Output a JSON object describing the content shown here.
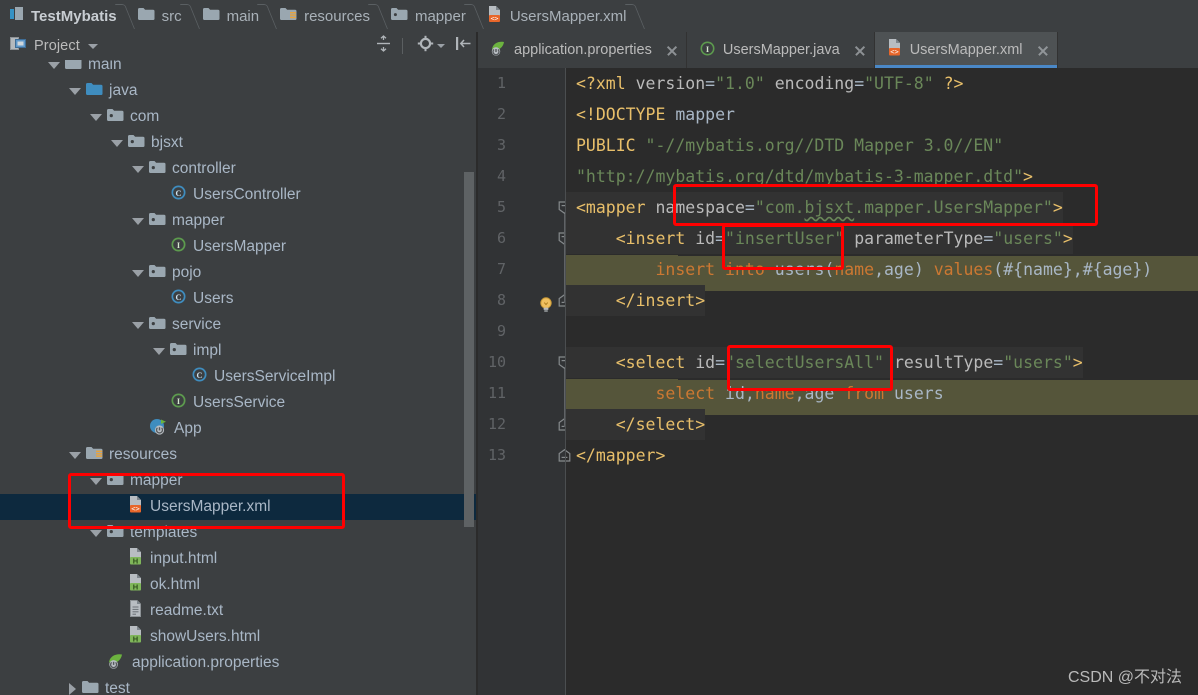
{
  "breadcrumb": {
    "items": [
      {
        "label": "TestMybatis",
        "icon": "module-icon"
      },
      {
        "label": "src",
        "icon": "folder-icon"
      },
      {
        "label": "main",
        "icon": "folder-icon"
      },
      {
        "label": "resources",
        "icon": "resources-folder-icon"
      },
      {
        "label": "mapper",
        "icon": "package-folder-icon"
      },
      {
        "label": "UsersMapper.xml",
        "icon": "xml-file-icon"
      }
    ]
  },
  "project_panel": {
    "title": "Project",
    "toolbar": [
      {
        "name": "expand-collapse-icon"
      },
      {
        "name": "gear-icon"
      },
      {
        "name": "hide-panel-icon"
      }
    ],
    "tree": [
      {
        "label": "main",
        "icon": "folder-icon",
        "indent": 2,
        "state": "expanded",
        "cut": true
      },
      {
        "label": "java",
        "icon": "source-folder-icon",
        "indent": 3,
        "state": "expanded"
      },
      {
        "label": "com",
        "icon": "package-folder-icon",
        "indent": 4,
        "state": "expanded"
      },
      {
        "label": "bjsxt",
        "icon": "package-folder-icon",
        "indent": 5,
        "state": "expanded"
      },
      {
        "label": "controller",
        "icon": "package-folder-icon",
        "indent": 6,
        "state": "expanded"
      },
      {
        "label": "UsersController",
        "icon": "class-icon",
        "indent": 7,
        "state": "leaf"
      },
      {
        "label": "mapper",
        "icon": "package-folder-icon",
        "indent": 6,
        "state": "expanded"
      },
      {
        "label": "UsersMapper",
        "icon": "interface-icon",
        "indent": 7,
        "state": "leaf"
      },
      {
        "label": "pojo",
        "icon": "package-folder-icon",
        "indent": 6,
        "state": "expanded"
      },
      {
        "label": "Users",
        "icon": "class-icon",
        "indent": 7,
        "state": "leaf"
      },
      {
        "label": "service",
        "icon": "package-folder-icon",
        "indent": 6,
        "state": "expanded"
      },
      {
        "label": "impl",
        "icon": "package-folder-icon",
        "indent": 7,
        "state": "expanded"
      },
      {
        "label": "UsersServiceImpl",
        "icon": "class-icon",
        "indent": 8,
        "state": "leaf"
      },
      {
        "label": "UsersService",
        "icon": "interface-icon",
        "indent": 7,
        "state": "leaf"
      },
      {
        "label": "App",
        "icon": "spring-boot-run-icon",
        "indent": 6,
        "state": "leaf"
      },
      {
        "label": "resources",
        "icon": "resources-folder-icon",
        "indent": 3,
        "state": "expanded"
      },
      {
        "label": "mapper",
        "icon": "package-folder-icon",
        "indent": 4,
        "state": "expanded"
      },
      {
        "label": "UsersMapper.xml",
        "icon": "xml-file-icon",
        "indent": 5,
        "state": "leaf",
        "selected": true
      },
      {
        "label": "templates",
        "icon": "package-folder-icon",
        "indent": 4,
        "state": "expanded"
      },
      {
        "label": "input.html",
        "icon": "html-file-icon",
        "indent": 5,
        "state": "leaf"
      },
      {
        "label": "ok.html",
        "icon": "html-file-icon",
        "indent": 5,
        "state": "leaf"
      },
      {
        "label": "readme.txt",
        "icon": "text-file-icon",
        "indent": 5,
        "state": "leaf"
      },
      {
        "label": "showUsers.html",
        "icon": "html-file-icon",
        "indent": 5,
        "state": "leaf"
      },
      {
        "label": "application.properties",
        "icon": "spring-properties-icon",
        "indent": 4,
        "state": "leaf"
      },
      {
        "label": "test",
        "icon": "folder-icon",
        "indent": 3,
        "state": "collapsed",
        "cut": true
      }
    ]
  },
  "editor_tabs": [
    {
      "label": "application.properties",
      "icon": "spring-properties-icon",
      "active": false,
      "closable": true
    },
    {
      "label": "UsersMapper.java",
      "icon": "interface-icon",
      "active": false,
      "closable": true
    },
    {
      "label": "UsersMapper.xml",
      "icon": "xml-file-icon",
      "active": true,
      "closable": true
    }
  ],
  "editor": {
    "filename": "UsersMapper.xml",
    "line_numbers": [
      "1",
      "2",
      "3",
      "4",
      "5",
      "6",
      "7",
      "8",
      "9",
      "10",
      "11",
      "12",
      "13"
    ],
    "lines": [
      {
        "n": 1,
        "text": "<?xml version=\"1.0\" encoding=\"UTF-8\" ?>"
      },
      {
        "n": 2,
        "text": "<!DOCTYPE mapper"
      },
      {
        "n": 3,
        "text": "PUBLIC \"-//mybatis.org//DTD Mapper 3.0//EN\""
      },
      {
        "n": 4,
        "text": "\"http://mybatis.org/dtd/mybatis-3-mapper.dtd\">"
      },
      {
        "n": 5,
        "text": "<mapper namespace=\"com.bjsxt.mapper.UsersMapper\">"
      },
      {
        "n": 6,
        "text": "    <insert id=\"insertUser\" parameterType=\"users\">"
      },
      {
        "n": 7,
        "text": "        insert into users(name,age) values(#{name},#{age})"
      },
      {
        "n": 8,
        "text": "    </insert>"
      },
      {
        "n": 9,
        "text": ""
      },
      {
        "n": 10,
        "text": "    <select id=\"selectUsersAll\" resultType=\"users\">"
      },
      {
        "n": 11,
        "text": "        select id,name,age from users"
      },
      {
        "n": 12,
        "text": "    </select>"
      },
      {
        "n": 13,
        "text": "</mapper>"
      }
    ]
  },
  "annotations": {
    "boxes": [
      {
        "name": "namespace-highlight-box",
        "color": "#ff0000"
      },
      {
        "name": "insert-id-highlight-box",
        "color": "#ff0000"
      },
      {
        "name": "select-id-highlight-box",
        "color": "#ff0000"
      },
      {
        "name": "mapper-xml-tree-highlight-box",
        "color": "#ff0000"
      }
    ]
  },
  "watermark": {
    "text": "CSDN @不对法"
  },
  "colors": {
    "accent": "#4a88c7",
    "panel_bg": "#3c3f41",
    "editor_bg": "#2b2b2b",
    "gutter_bg": "#313335",
    "selection_bg": "#0d293e",
    "highlight_olive": "#55553a",
    "annotation_red": "#ff0000"
  }
}
